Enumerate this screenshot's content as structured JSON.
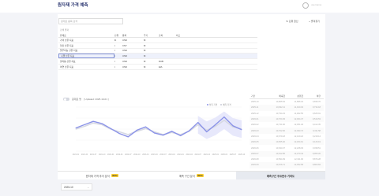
{
  "header": {
    "title": "원자재 가격 예측",
    "user": "username"
  },
  "toolbar": {
    "search_placeholder": "원재료 품목 검색",
    "select_label": "단위 환산",
    "add_label": "즐겨찾기",
    "list_label": "검색 결과"
  },
  "table": {
    "headers": [
      "원재료",
      "단위",
      "통화",
      "",
      "주기",
      "출처",
      "비고"
    ],
    "rows": [
      [
        "가격 선물 지표",
        "lb",
        "USD",
        "",
        "M",
        "",
        ""
      ],
      [
        "철강 선물 지표",
        "t",
        "CNY",
        "",
        "M",
        "",
        ""
      ],
      [
        "알루미늄 선물 지표",
        "t",
        "USD",
        "",
        "M",
        "",
        ""
      ],
      [
        "니켈 선물 지표",
        "t",
        "USD",
        "",
        "M",
        "",
        ""
      ],
      [
        "팔라듐 선물 지표",
        "t",
        "USD",
        "",
        "M",
        "DUB",
        ""
      ],
      [
        "아연 선물 지표",
        "t",
        "USD",
        "",
        "M",
        "EIA",
        ""
      ]
    ],
    "selected_row": 3
  },
  "chart": {
    "title": "원재료 명",
    "updated": "[ Updated: 2025-10-01 ]",
    "legend": [
      "실측 가격",
      "예측 가격"
    ],
    "colors": {
      "actual": "#8b93e8",
      "forecast": "#d7d9e3",
      "band": "#e4e6fb"
    }
  },
  "chart_data": {
    "type": "line",
    "title": "",
    "x": [
      "2021-01",
      "2021-04",
      "2021-07",
      "2021-10",
      "2022-01",
      "2022-04",
      "2022-07",
      "2022-10",
      "2023-01",
      "2023-04",
      "2023-07",
      "2023-10",
      "2024-01",
      "2024-04",
      "2024-07",
      "2024-10",
      "2025-01",
      "2025-04",
      "2025-07",
      "2025-10"
    ],
    "series": [
      {
        "name": "실측 가격",
        "values": [
          6.2,
          6.8,
          7.4,
          7.0,
          6.1,
          5.2,
          4.6,
          5.8,
          6.4,
          5.3,
          4.9,
          5.6,
          4.8,
          5.7,
          7.2,
          5.5,
          6.8,
          8.2,
          6.6,
          5.9
        ]
      },
      {
        "name": "예측 가격",
        "values": [
          6.0,
          6.5,
          7.1,
          6.8,
          6.0,
          5.5,
          5.0,
          5.6,
          6.1,
          5.5,
          5.0,
          5.4,
          5.0,
          5.6,
          6.8,
          5.8,
          6.5,
          7.6,
          6.4,
          6.0
        ]
      }
    ],
    "ylim": [
      2,
      10
    ],
    "yticks": [
      "",
      "",
      "",
      "",
      ""
    ]
  },
  "side_table": {
    "headers": [
      "기간",
      "예측값",
      "상한값",
      "하한"
    ],
    "rows": [
      [
        "2025-10",
        "10,865.54",
        "11,895.32",
        "9,835.76"
      ],
      [
        "2025-11",
        "10,822.11",
        "11,910.04",
        "9,734.18"
      ],
      [
        "2025-12",
        "10,794.23",
        "11,962.55",
        "9,625.91"
      ],
      [
        "2026-01",
        "10,760.45",
        "12,004.37",
        "9,516.53"
      ],
      [
        "2026-02",
        "10,731.82",
        "12,051.29",
        "9,412.35"
      ],
      [
        "2026-03",
        "10,702.66",
        "12,093.74",
        "9,311.58"
      ],
      [
        "2026-04",
        "10,679.18",
        "12,140.22",
        "9,218.14"
      ],
      [
        "2026-05",
        "10,655.40",
        "12,184.61",
        "9,126.19"
      ],
      [
        "2026-06",
        "10,633.27",
        "12,228.03",
        "9,038.51"
      ],
      [
        "2026-07",
        "10,612.85",
        "12,270.44",
        "8,955.26"
      ],
      [
        "2026-08",
        "10,594.09",
        "12,311.90",
        "8,876.28"
      ],
      [
        "2026-09",
        "10,576.71",
        "12,352.58",
        "8,800.84"
      ]
    ]
  },
  "tabs": [
    {
      "label": "원자재 가격 추이 분석",
      "badge": "BETA"
    },
    {
      "label": "예측 구간 분석",
      "badge": "BETA"
    },
    {
      "label": "예측구간 주요변수 기여도",
      "badge": ""
    }
  ],
  "month_select": {
    "value": "2025-10"
  }
}
